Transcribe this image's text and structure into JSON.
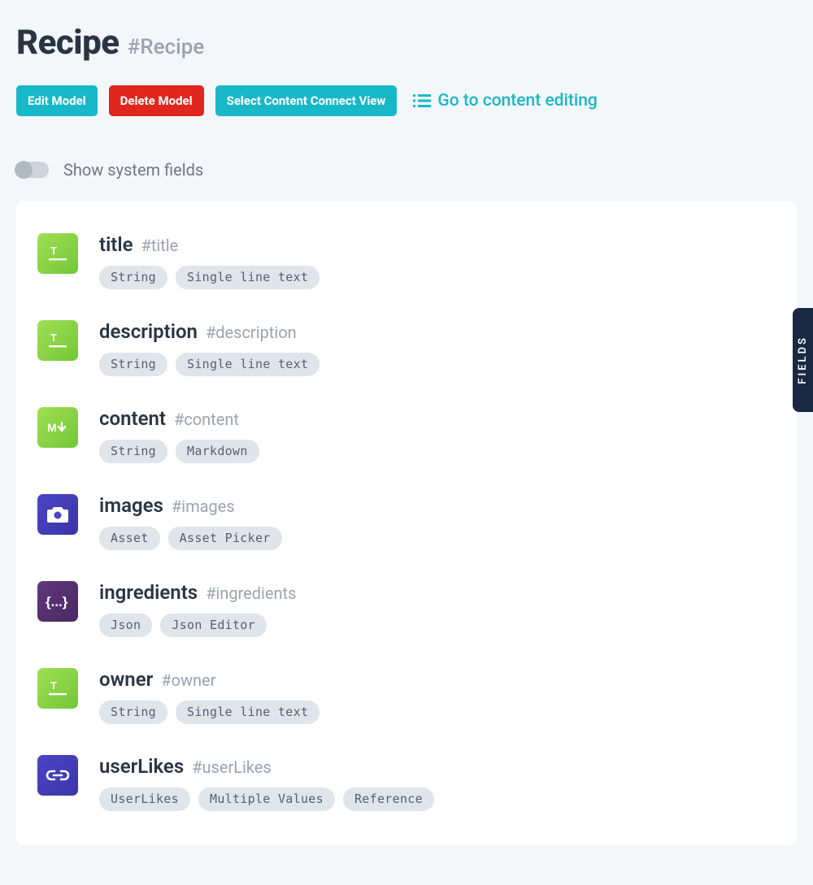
{
  "header": {
    "title": "Recipe",
    "hash": "#Recipe"
  },
  "actions": {
    "edit": "Edit Model",
    "delete": "Delete Model",
    "select_view": "Select Content Connect View",
    "goto": "Go to content editing"
  },
  "toggle": {
    "label": "Show system fields"
  },
  "sideTab": "FIELDS",
  "fields": [
    {
      "name": "title",
      "hash": "#title",
      "icon": "text",
      "iconClass": "icon-green",
      "tags": [
        "String",
        "Single line text"
      ]
    },
    {
      "name": "description",
      "hash": "#description",
      "icon": "text",
      "iconClass": "icon-green",
      "tags": [
        "String",
        "Single line text"
      ]
    },
    {
      "name": "content",
      "hash": "#content",
      "icon": "markdown",
      "iconClass": "icon-green",
      "tags": [
        "String",
        "Markdown"
      ]
    },
    {
      "name": "images",
      "hash": "#images",
      "icon": "camera",
      "iconClass": "icon-indigo",
      "tags": [
        "Asset",
        "Asset Picker"
      ]
    },
    {
      "name": "ingredients",
      "hash": "#ingredients",
      "icon": "json",
      "iconClass": "icon-purple",
      "tags": [
        "Json",
        "Json Editor"
      ]
    },
    {
      "name": "owner",
      "hash": "#owner",
      "icon": "text",
      "iconClass": "icon-green",
      "tags": [
        "String",
        "Single line text"
      ]
    },
    {
      "name": "userLikes",
      "hash": "#userLikes",
      "icon": "link",
      "iconClass": "icon-indigo",
      "tags": [
        "UserLikes",
        "Multiple Values",
        "Reference"
      ]
    }
  ]
}
